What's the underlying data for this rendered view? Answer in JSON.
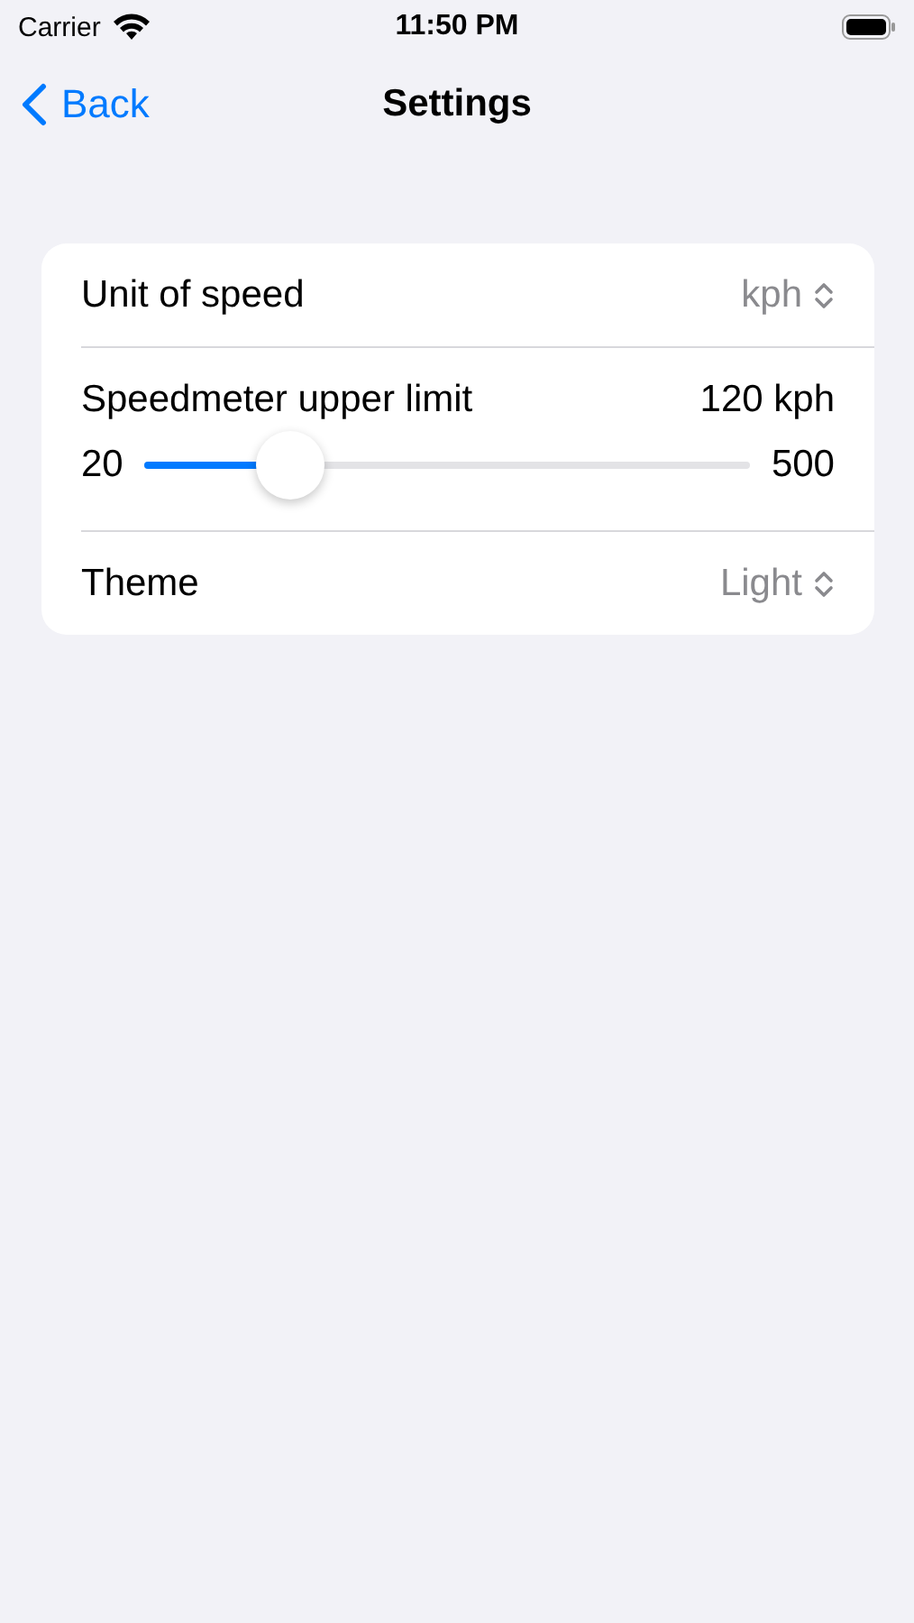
{
  "status_bar": {
    "carrier": "Carrier",
    "time": "11:50 PM"
  },
  "nav": {
    "back": "Back",
    "title": "Settings"
  },
  "rows": [
    {
      "kind": "picker",
      "label": "Unit of speed",
      "value": "kph"
    },
    {
      "kind": "slider",
      "label": "Speedmeter upper limit",
      "value": "120 kph",
      "min": "20",
      "max": "500",
      "level": 0.24
    },
    {
      "kind": "picker",
      "label": "Theme",
      "value": "Light"
    }
  ]
}
